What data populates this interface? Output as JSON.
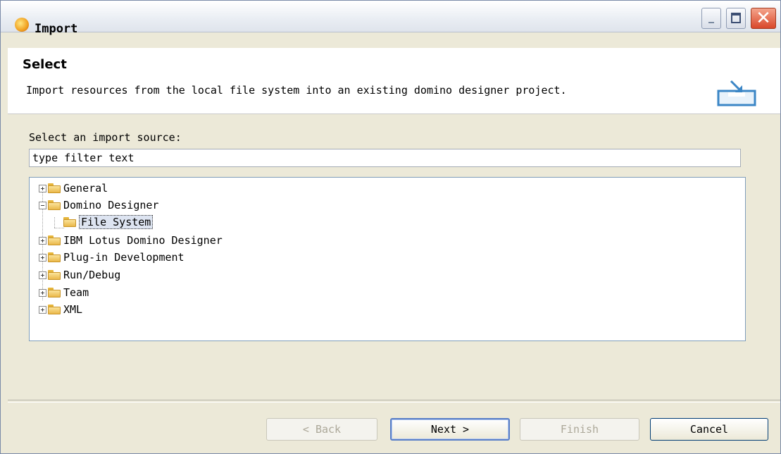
{
  "window": {
    "title": "Import",
    "close_symbol": "✕"
  },
  "header": {
    "title": "Select",
    "description": "Import resources from the local file system into an existing domino designer project."
  },
  "source": {
    "label": "Select an import source:",
    "filter_value": "type filter text"
  },
  "tree": {
    "items": [
      {
        "label": "General",
        "toggle": "+"
      },
      {
        "label": "Domino Designer",
        "toggle": "−"
      },
      {
        "label": "File System",
        "toggle": ""
      },
      {
        "label": "IBM Lotus Domino Designer",
        "toggle": "+"
      },
      {
        "label": "Plug-in Development",
        "toggle": "+"
      },
      {
        "label": "Run/Debug",
        "toggle": "+"
      },
      {
        "label": "Team",
        "toggle": "+"
      },
      {
        "label": "XML",
        "toggle": "+"
      }
    ]
  },
  "buttons": {
    "back": "< Back",
    "next": "Next >",
    "finish": "Finish",
    "cancel": "Cancel"
  },
  "colors": {
    "dialog_bg": "#ece9d8",
    "selection_bg": "#dde4f1",
    "default_button_border": "#5a7fc7"
  }
}
